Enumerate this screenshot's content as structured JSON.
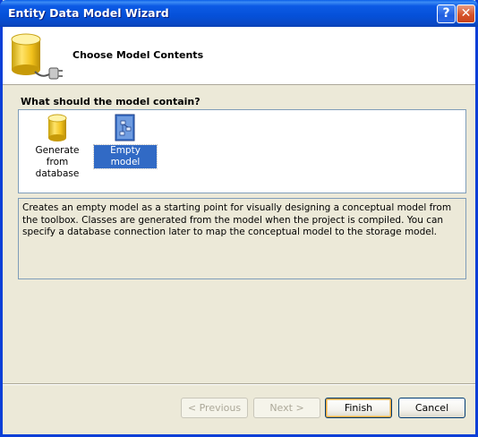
{
  "window": {
    "title": "Entity Data Model Wizard",
    "help_glyph": "?",
    "close_glyph": "✕"
  },
  "header": {
    "title": "Choose Model Contents",
    "icon": "database-plug-icon"
  },
  "question": "What should the model contain?",
  "options": [
    {
      "label_line1": "Generate from",
      "label_line2": "database",
      "icon": "database-icon",
      "selected": false
    },
    {
      "label": "Empty model",
      "icon": "empty-model-document-icon",
      "selected": true
    }
  ],
  "description": "Creates an empty model as a starting point for visually designing a conceptual model from the toolbox. Classes are generated from the model when the project is compiled. You can specify a database connection later to map the conceptual model to the storage model.",
  "buttons": {
    "previous": "< Previous",
    "next": "Next >",
    "finish": "Finish",
    "cancel": "Cancel"
  },
  "colors": {
    "titlebar": "#0550d8",
    "selection": "#316ac5",
    "dialog_bg": "#ece9d8"
  }
}
